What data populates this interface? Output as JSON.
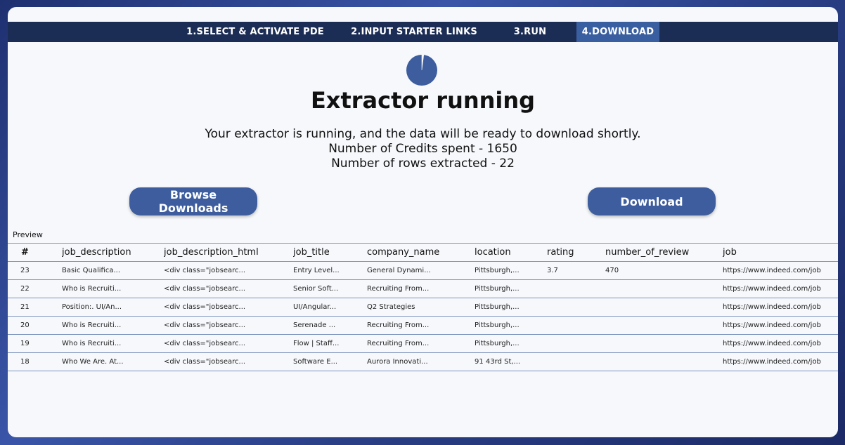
{
  "steps": [
    {
      "label": "1.SELECT & ACTIVATE PDE",
      "active": false
    },
    {
      "label": "2.INPUT STARTER LINKS",
      "active": false
    },
    {
      "label": "3.RUN",
      "active": false
    },
    {
      "label": "4.DOWNLOAD",
      "active": true
    }
  ],
  "status": {
    "title": "Extractor running",
    "message": "Your extractor is running, and the data will be ready to download shortly.",
    "credits_line": "Number of Credits spent - 1650",
    "rows_line": "Number of rows extracted - 22",
    "progress_fraction": 0.02
  },
  "colors": {
    "accent": "#3d5d9e",
    "stepbar": "#1c2d55",
    "active_step": "#3a5fa0"
  },
  "buttons": {
    "browse_label": "Browse Downloads",
    "download_label": "Download"
  },
  "preview": {
    "label": "Preview",
    "columns": [
      "#",
      "job_description",
      "job_description_html",
      "job_title",
      "company_name",
      "location",
      "rating",
      "number_of_review",
      "job"
    ],
    "rows": [
      [
        "23",
        "Basic Qualifica...",
        "<div class=\"jobsearc...",
        "Entry Level...",
        "General Dynami...",
        "Pittsburgh,...",
        "3.7",
        "470",
        "https://www.indeed.com/job"
      ],
      [
        "22",
        "Who is Recruiti...",
        "<div class=\"jobsearc...",
        "Senior Soft...",
        "Recruiting From...",
        "Pittsburgh,...",
        "",
        "",
        "https://www.indeed.com/job"
      ],
      [
        "21",
        "Position:. UI/An...",
        "<div class=\"jobsearc...",
        "UI/Angular...",
        "Q2 Strategies",
        "Pittsburgh,...",
        "",
        "",
        "https://www.indeed.com/job"
      ],
      [
        "20",
        "Who is Recruiti...",
        "<div class=\"jobsearc...",
        "Serenade ...",
        "Recruiting From...",
        "Pittsburgh,...",
        "",
        "",
        "https://www.indeed.com/job"
      ],
      [
        "19",
        "Who is Recruiti...",
        "<div class=\"jobsearc...",
        "Flow | Staff...",
        "Recruiting From...",
        "Pittsburgh,...",
        "",
        "",
        "https://www.indeed.com/job"
      ],
      [
        "18",
        "Who We Are. At...",
        "<div class=\"jobsearc...",
        "Software E...",
        "Aurora Innovati...",
        "91 43rd St,...",
        "",
        "",
        "https://www.indeed.com/job"
      ]
    ]
  }
}
